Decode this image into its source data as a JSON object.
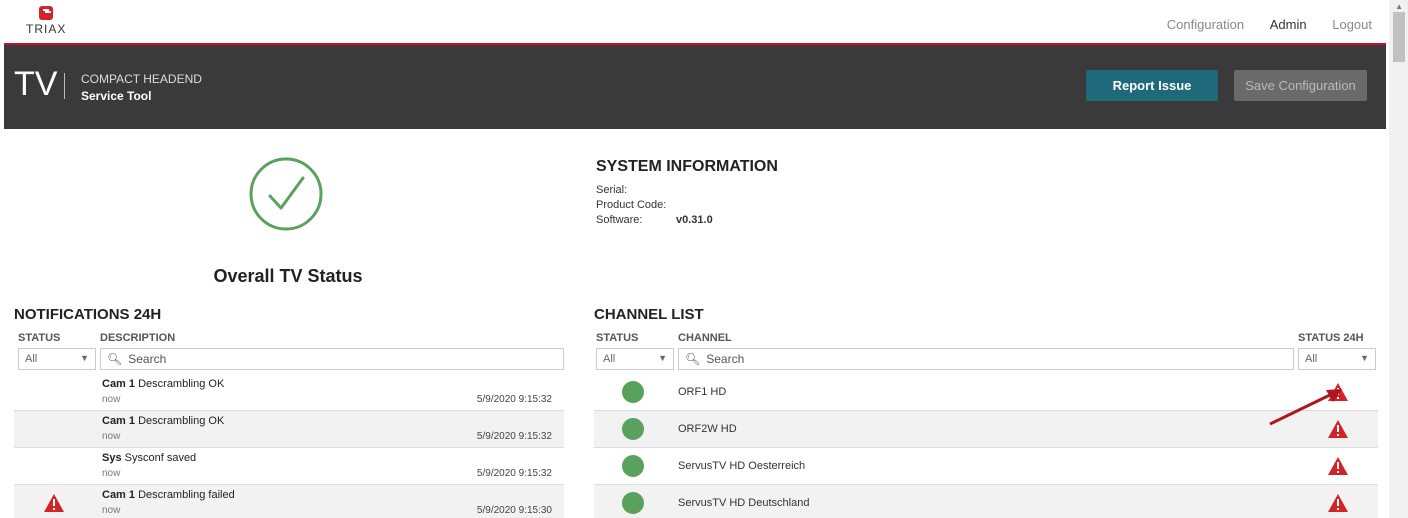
{
  "brand": {
    "logo_text": "TRIAX"
  },
  "topnav": {
    "configuration": "Configuration",
    "admin": "Admin",
    "logout": "Logout"
  },
  "header": {
    "product": "TV",
    "line1": "COMPACT HEADEND",
    "line2": "Service Tool",
    "report_issue": "Report Issue",
    "save_configuration": "Save Configuration"
  },
  "overall": {
    "label": "Overall TV Status",
    "status_color": "#5aa15e"
  },
  "system_info": {
    "title": "SYSTEM INFORMATION",
    "serial_label": "Serial:",
    "serial_value": "",
    "product_code_label": "Product Code:",
    "product_code_value": "",
    "software_label": "Software:",
    "software_value": "v0.31.0"
  },
  "notifications": {
    "title": "NOTIFICATIONS 24H",
    "col_status": "STATUS",
    "col_description": "DESCRIPTION",
    "status_filter": "All",
    "search_placeholder": "Search",
    "rows": [
      {
        "source": "Cam 1",
        "message": "Descrambling OK",
        "when": "now",
        "timestamp": "5/9/2020 9:15:32",
        "warning": false
      },
      {
        "source": "Cam 1",
        "message": "Descrambling OK",
        "when": "now",
        "timestamp": "5/9/2020 9:15:32",
        "warning": false
      },
      {
        "source": "Sys",
        "message": "Sysconf saved",
        "when": "now",
        "timestamp": "5/9/2020 9:15:32",
        "warning": false
      },
      {
        "source": "Cam 1",
        "message": "Descrambling failed",
        "when": "now",
        "timestamp": "5/9/2020 9:15:30",
        "warning": true
      }
    ]
  },
  "channels": {
    "title": "CHANNEL LIST",
    "col_status": "STATUS",
    "col_channel": "CHANNEL",
    "col_status24": "STATUS 24H",
    "status_filter": "All",
    "status24_filter": "All",
    "search_placeholder": "Search",
    "rows": [
      {
        "name": "ORF1 HD",
        "status": "ok",
        "status24": "warning"
      },
      {
        "name": "ORF2W HD",
        "status": "ok",
        "status24": "warning"
      },
      {
        "name": "ServusTV HD Oesterreich",
        "status": "ok",
        "status24": "warning"
      },
      {
        "name": "ServusTV HD Deutschland",
        "status": "ok",
        "status24": "warning"
      }
    ]
  },
  "colors": {
    "accent": "#1f6a7a",
    "brand_red": "#c8102e",
    "ok_green": "#5aa15e",
    "warning_red": "#d2232a"
  }
}
